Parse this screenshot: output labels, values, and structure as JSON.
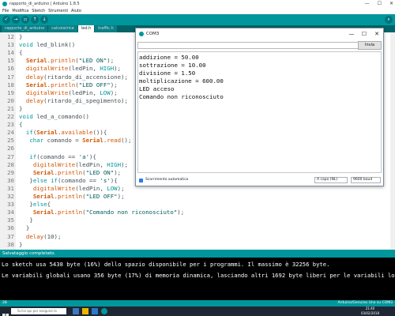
{
  "window": {
    "title": "rapporto_di_arduino | Arduino 1.8.5",
    "controls": [
      "—",
      "☐",
      "✕"
    ]
  },
  "menu": [
    "File",
    "Modifica",
    "Sketch",
    "Strumenti",
    "Aiuto"
  ],
  "tabs": [
    {
      "label": "rapporto_di_arduino",
      "active": false
    },
    {
      "label": "calcolatrice",
      "active": false
    },
    {
      "label": "led.h",
      "active": true
    },
    {
      "label": "traffic.h",
      "active": false
    }
  ],
  "editor": {
    "lines": [
      {
        "num": "12",
        "text": "}"
      },
      {
        "num": "13",
        "text": "void led_blink()"
      },
      {
        "num": "14",
        "text": "{"
      },
      {
        "num": "15",
        "text": "  Serial.println(\"LED ON\");"
      },
      {
        "num": "16",
        "text": "  digitalWrite(ledPin, HIGH);"
      },
      {
        "num": "17",
        "text": "  delay(ritardo_di_accensione);"
      },
      {
        "num": "18",
        "text": "  Serial.println(\"LED OFF\");"
      },
      {
        "num": "19",
        "text": "  digitalWrite(ledPin, LOW);"
      },
      {
        "num": "20",
        "text": "  delay(ritardo_di_spegimento);"
      },
      {
        "num": "21",
        "text": "}"
      },
      {
        "num": "22",
        "text": "void led_a_comando()"
      },
      {
        "num": "23",
        "text": "{"
      },
      {
        "num": "24",
        "text": "  if(Serial.available()){"
      },
      {
        "num": "25",
        "text": "   char comando = Serial.read();"
      },
      {
        "num": "26",
        "text": ""
      },
      {
        "num": "27",
        "text": "   if(comando == 'a'){"
      },
      {
        "num": "28",
        "text": "    digitalWrite(ledPin, HIGH);"
      },
      {
        "num": "29",
        "text": "    Serial.println(\"LED ON\");"
      },
      {
        "num": "30",
        "text": "   }else if(comando == 's'){"
      },
      {
        "num": "31",
        "text": "    digitalWrite(ledPin, LOW);"
      },
      {
        "num": "32",
        "text": "    Serial.println(\"LED OFF\");"
      },
      {
        "num": "33",
        "text": "   }else{"
      },
      {
        "num": "34",
        "text": "    Serial.println(\"Comando non riconosciuto\");"
      },
      {
        "num": "35",
        "text": "   }"
      },
      {
        "num": "36",
        "text": "  }"
      },
      {
        "num": "37",
        "text": "  delay(10);"
      },
      {
        "num": "38",
        "text": "}"
      }
    ]
  },
  "status": {
    "text": "Salvataggio completato."
  },
  "console": {
    "lines": [
      "Lo sketch usa 5438 byte (16%) dello spazio disponibile per i programmi. Il massimo è 32256 byte.",
      "Le variabili globali usano 356 byte (17%) di memoria dinamica, lasciando altri 1692 byte liberi per le variabili loc"
    ]
  },
  "infobar": {
    "line": "28",
    "board": "Arduino/Genuino Uno su COM3"
  },
  "taskbar": {
    "search_placeholder": "Scrivi qui per eseguire la ricerca",
    "time": "21:40",
    "date": "03/02/2018"
  },
  "serial": {
    "title": "COM3",
    "input_value": "",
    "send_label": "Invia",
    "output": [
      "addizione = 50.00",
      "sottrazione = 10.00",
      "divisione = 1.50",
      "moltiplicazione = 600.00",
      "LED acceso",
      "Comando non riconosciuto"
    ],
    "autoscroll_label": "Scorrimento automatico",
    "autoscroll_checked": true,
    "line_ending": "A capo (NL)",
    "baud": "9600 baud"
  },
  "colors": {
    "accent": "#00979c",
    "toolbar_dark": "#006468",
    "console_bg": "#000000"
  }
}
